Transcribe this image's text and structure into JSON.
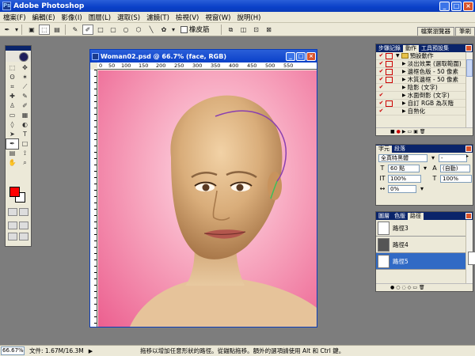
{
  "app": {
    "title": "Adobe Photoshop"
  },
  "menu": [
    "檔案(F)",
    "編輯(E)",
    "影像(I)",
    "圖層(L)",
    "選取(S)",
    "濾鏡(T)",
    "檢視(V)",
    "視窗(W)",
    "說明(H)"
  ],
  "options_bar": {
    "rubber_band_label": "橡皮筋"
  },
  "palette_well": {
    "tabs": [
      "檔案瀏覽器",
      "筆刷"
    ]
  },
  "document": {
    "title": "Woman02.psd @ 66.7% (face, RGB)",
    "ruler_ticks": [
      "100",
      "150",
      "200",
      "250",
      "300",
      "350",
      "400",
      "450",
      "500",
      "550"
    ],
    "ruler_ticks_2": [
      "0",
      "50",
      "1"
    ]
  },
  "actions_palette": {
    "tabs": [
      "步驟記錄",
      "動作",
      "工具預設集"
    ],
    "set_name": "預設動作",
    "items": [
      "淡出效果 (選取範圍)",
      "邊框色版 - 50 像素",
      "木質邊框 - 50 像素",
      "陰影 (文字)",
      "水面倒影 (文字)",
      "自訂 RGB 為灰階",
      "自熟化"
    ]
  },
  "character_palette": {
    "tabs": [
      "字元",
      "段落"
    ],
    "font": "全真特黑體",
    "style": "-",
    "size": "60 點",
    "leading": "(自動)",
    "vscale": "100%",
    "hscale": "100%",
    "tracking": "0%"
  },
  "paths_palette": {
    "tabs": [
      "圖層",
      "色版",
      "路徑"
    ],
    "items": [
      {
        "label": "路徑3",
        "active": false
      },
      {
        "label": "路徑4",
        "active": false
      },
      {
        "label": "路徑5",
        "active": true
      }
    ]
  },
  "statusbar": {
    "zoom": "66.67%",
    "doc_info": "文件: 1.67M/16.3M",
    "hint": "拖移以增加任意形狀的路徑。從錨點拖移。額外的選項請使用 Alt 和 Ctrl 鍵。"
  },
  "colors": {
    "foreground": "#ff0000",
    "background": "#ffffff",
    "canvas_bg": "#ec5f8f",
    "accent": "#0a40c8"
  }
}
